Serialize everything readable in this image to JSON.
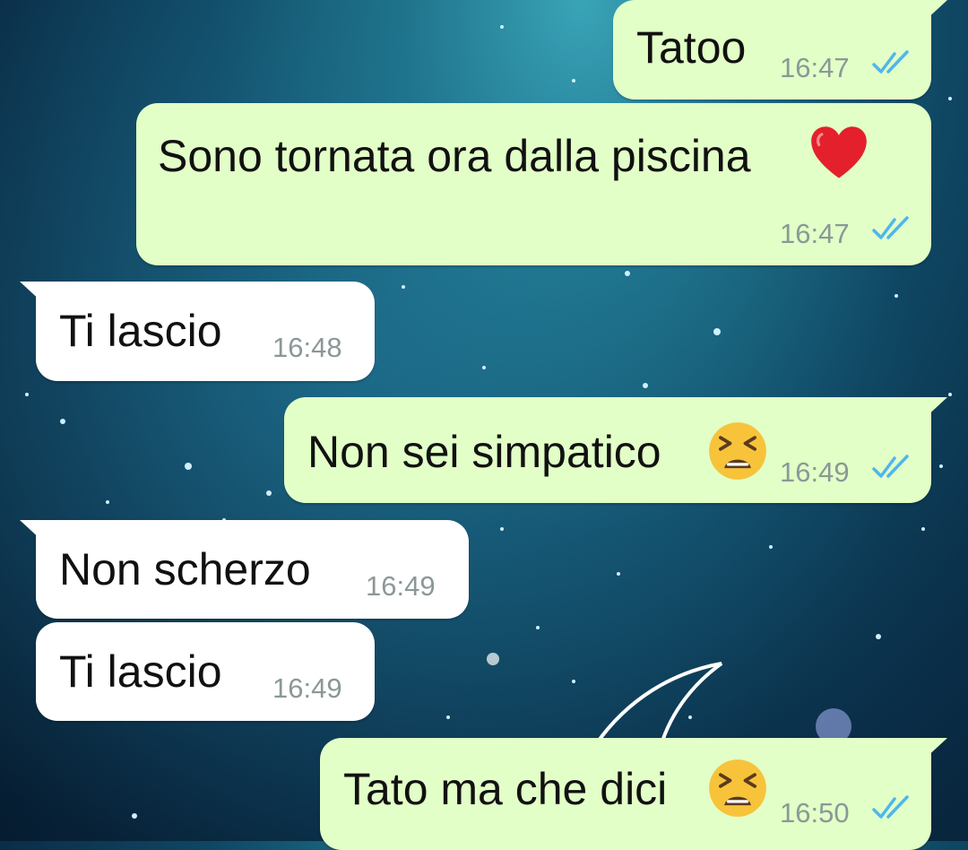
{
  "messages": [
    {
      "direction": "out",
      "text": "Tatoo",
      "time": "16:47",
      "status": "read",
      "emoji": null
    },
    {
      "direction": "out",
      "text": "Sono tornata ora dalla piscina",
      "time": "16:47",
      "status": "read",
      "emoji": "red-heart"
    },
    {
      "direction": "in",
      "text": "Ti lascio",
      "time": "16:48",
      "emoji": null
    },
    {
      "direction": "out",
      "text": "Non sei simpatico",
      "time": "16:49",
      "status": "read",
      "emoji": "tired-face"
    },
    {
      "direction": "in",
      "text": "Non scherzo",
      "time": "16:49",
      "emoji": null
    },
    {
      "direction": "in",
      "text": "Ti lascio",
      "time": "16:49",
      "emoji": null
    },
    {
      "direction": "out",
      "text": "Tato ma che dici",
      "time": "16:50",
      "status": "read",
      "emoji": "tired-face"
    }
  ],
  "colors": {
    "outgoing_bubble": "#e2ffc7",
    "incoming_bubble": "#ffffff",
    "read_ticks": "#4fb6ec",
    "timestamp": "#8b9897"
  }
}
